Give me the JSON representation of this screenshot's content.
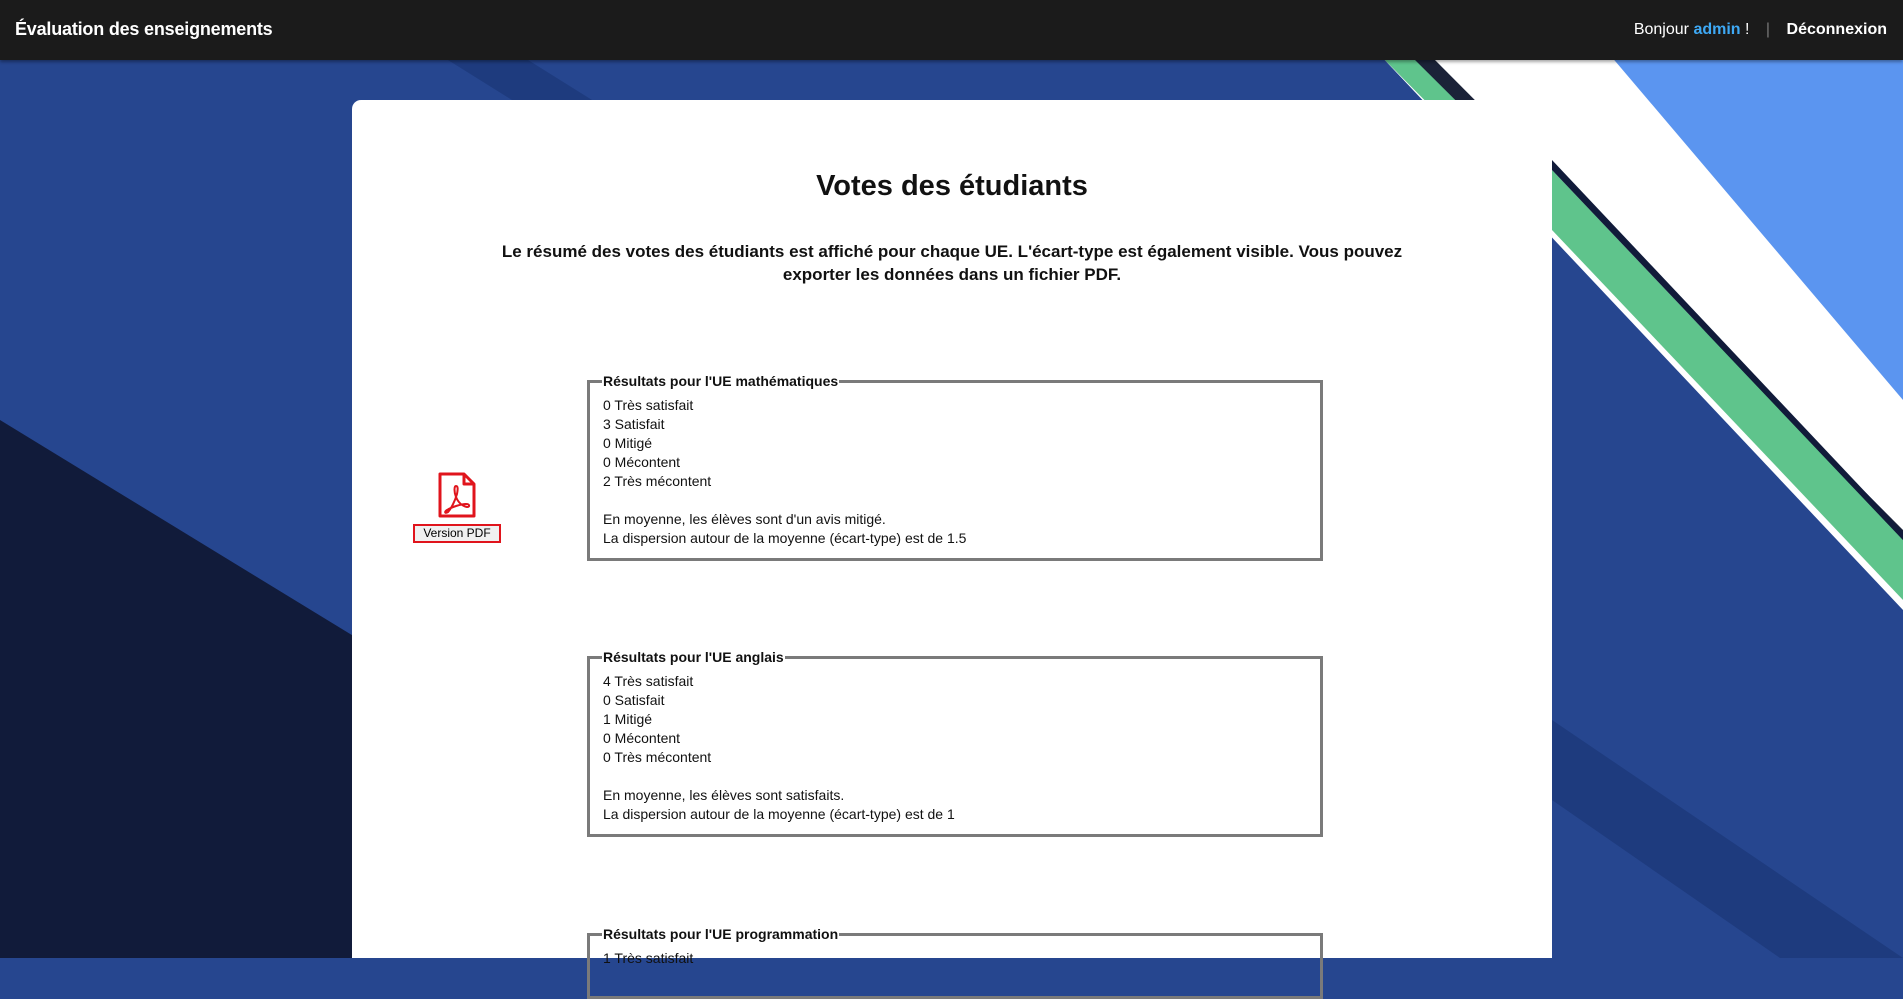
{
  "header": {
    "brand": "Évaluation des enseignements",
    "greeting": "Bonjour",
    "username": "admin",
    "exclamation": "!",
    "separator": "|",
    "logout_label": "Déconnexion"
  },
  "main": {
    "title": "Votes des étudiants",
    "intro": "Le résumé des votes des étudiants est affiché pour chaque UE. L'écart-type est également visible. Vous pouvez exporter les données dans un fichier PDF.",
    "pdf_button_label": "Version PDF",
    "pdf_icon": "pdf-file-icon",
    "results": [
      {
        "legend": "Résultats pour l'UE mathématiques",
        "votes": [
          "0 Très satisfait",
          "3 Satisfait",
          "0 Mitigé",
          "0 Mécontent",
          "2 Très mécontent"
        ],
        "summary": "En moyenne, les élèves sont d'un avis mitigé.",
        "dispersion": "La dispersion autour de la moyenne (écart-type) est de 1.5"
      },
      {
        "legend": "Résultats pour l'UE anglais",
        "votes": [
          "4 Très satisfait",
          "0 Satisfait",
          "1 Mitigé",
          "0 Mécontent",
          "0 Très mécontent"
        ],
        "summary": "En moyenne, les élèves sont satisfaits.",
        "dispersion": "La dispersion autour de la moyenne (écart-type) est de 1"
      },
      {
        "legend": "Résultats pour l'UE programmation",
        "votes": [
          "1 Très satisfait"
        ]
      }
    ]
  },
  "colors": {
    "topbar": "#1b1b1b",
    "username": "#3ea9f5",
    "pdf_red": "#e0141c",
    "bg_blue": "#26468f",
    "bg_navy": "#111b3a",
    "bg_light_blue": "#5b95f0",
    "bg_green": "#5fc48c"
  }
}
